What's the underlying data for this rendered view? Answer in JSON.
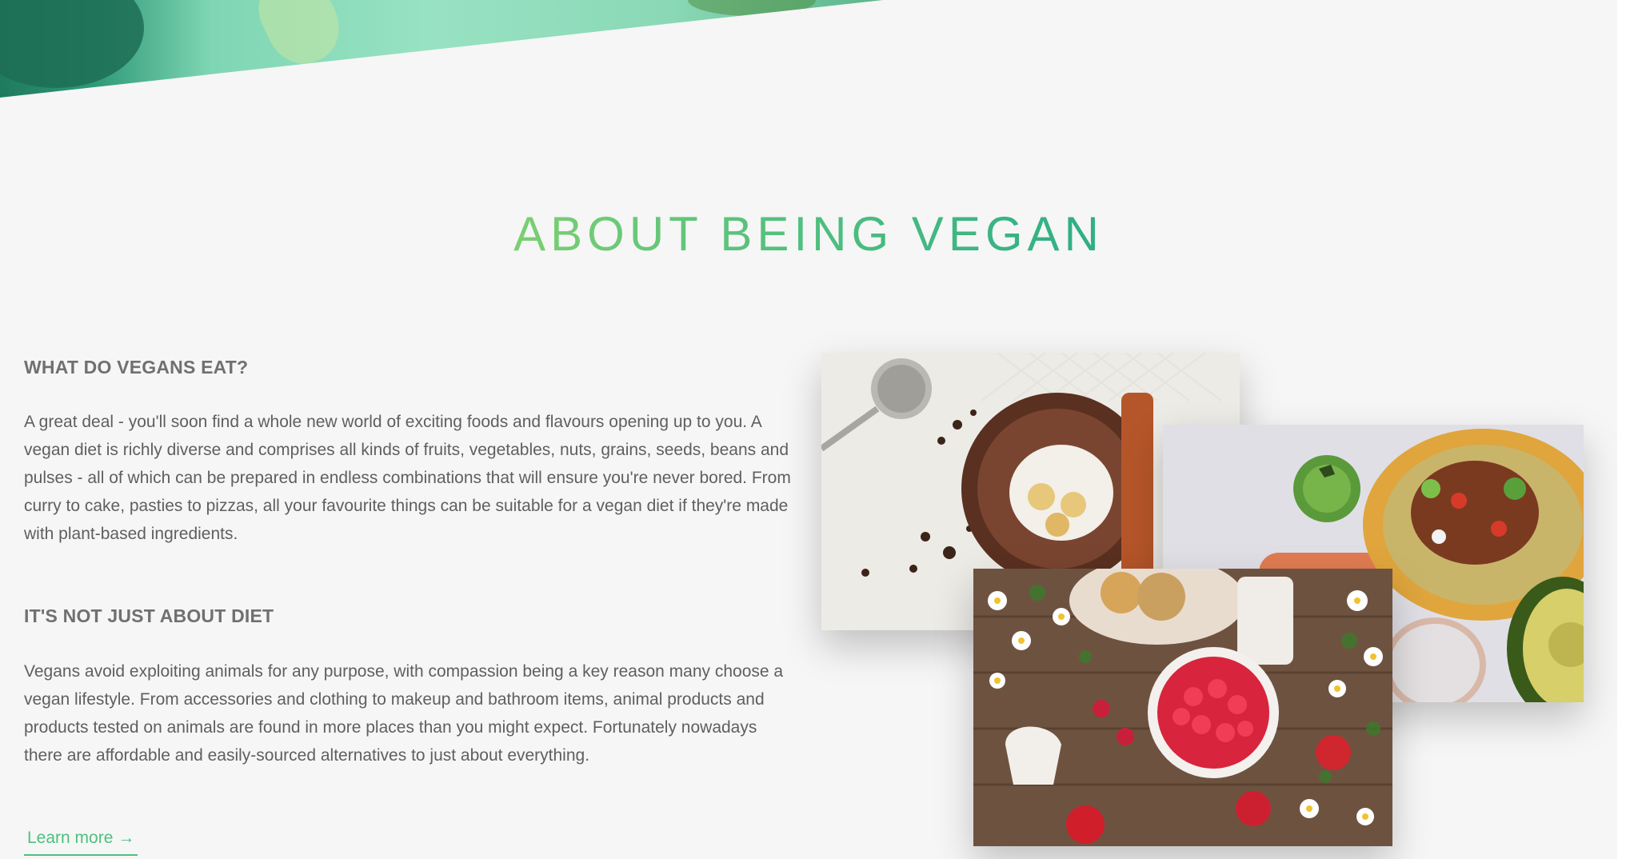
{
  "section": {
    "title": "ABOUT BEING VEGAN"
  },
  "blocks": [
    {
      "heading": "WHAT DO VEGANS EAT?",
      "body": "A great deal - you'll soon find a whole new world of exciting foods and flavours opening up to you. A vegan diet is richly diverse and comprises all kinds of fruits, vegetables, nuts, grains, seeds, beans and pulses - all of which can be prepared in endless combinations that will ensure you're never bored. From curry to cake, pasties to pizzas, all your favourite things can be suitable for a vegan diet if they're made with plant-based ingredients."
    },
    {
      "heading": "IT'S NOT JUST ABOUT DIET",
      "body": "Vegans avoid exploiting animals for any purpose, with compassion being a key reason many choose a vegan lifestyle. From accessories and clothing to makeup and bathroom items, animal products and products tested on animals are found in more places than you might expect. Fortunately nowadays there are affordable and easily-sourced alternatives to just about everything."
    }
  ],
  "cta": {
    "label": "Learn more",
    "arrow": "→"
  },
  "colors": {
    "accent_green": "#4fbf7f",
    "heading_gray": "#707070",
    "body_gray": "#5f5f5f",
    "page_bg": "#f6f6f6"
  },
  "images": [
    {
      "name": "chocolate-dessert-photo"
    },
    {
      "name": "vegan-tacos-photo"
    },
    {
      "name": "raspberries-flowers-photo"
    }
  ]
}
